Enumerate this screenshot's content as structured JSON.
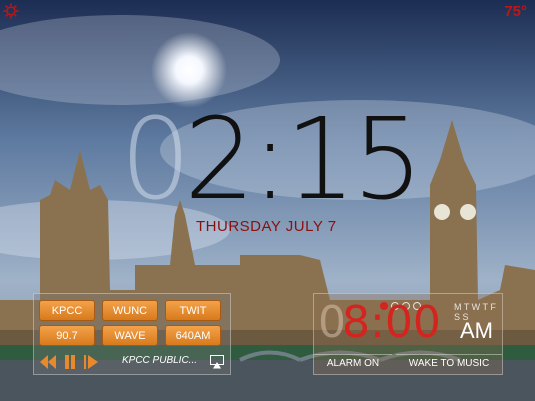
{
  "status": {
    "temperature": "75°"
  },
  "clock": {
    "ghost_digit": "0",
    "time": "2:15",
    "date": "THURSDAY JULY 7"
  },
  "radio": {
    "stations": [
      "KPCC",
      "WUNC",
      "TWIT",
      "90.7",
      "WAVE",
      "640AM"
    ],
    "now_playing": "KPCC PUBLIC..."
  },
  "alarm": {
    "ghost": "0",
    "time": "8:00",
    "ampm": "AM",
    "days": "M T W T F S S",
    "alarm_on_label": "ALARM ON",
    "wake_label": "WAKE TO MUSIC"
  },
  "colors": {
    "accent_red": "#c21515",
    "station_orange": "#e8892b"
  },
  "icons": [
    "settings-icon",
    "prev-icon",
    "pause-icon",
    "next-icon",
    "airplay-icon"
  ]
}
